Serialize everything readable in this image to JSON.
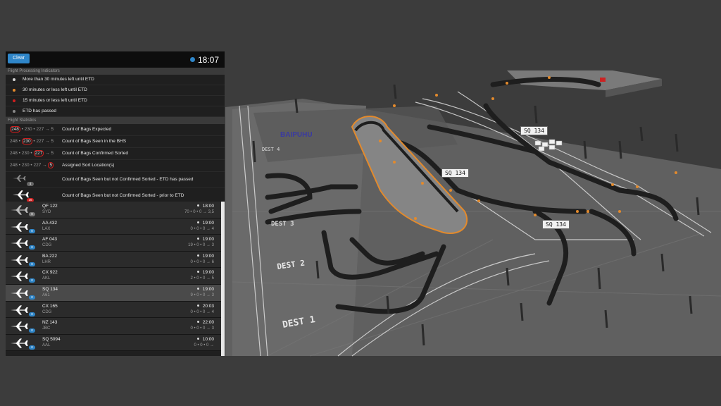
{
  "colors": {
    "accent": "#2f86c9",
    "alert": "#d01e1e",
    "conveyor_dot": "#e38a2c"
  },
  "header": {
    "clear_label": "Clear",
    "time": "18:07"
  },
  "indicators": {
    "title": "Flight Processing Indicators",
    "items": [
      {
        "label": "More than 30 minutes left until ETD",
        "color": "#d8d8d8"
      },
      {
        "label": "30 minutes or less left until ETD",
        "color": "#e38a2c"
      },
      {
        "label": "15 minutes or less left until ETD",
        "color": "#d01e1e"
      },
      {
        "label": "ETD has passed",
        "color": "#888888"
      }
    ]
  },
  "statistics": {
    "title": "Flight Statistics",
    "sep": "•",
    "arrow": "→",
    "values": [
      "248",
      "230",
      "227",
      "5"
    ],
    "rows": [
      {
        "label": "Count of Bags Expected"
      },
      {
        "label": "Count of Bags Seen in the BHS"
      },
      {
        "label": "Count of Bags Confirmed Sorted"
      },
      {
        "label": "Assigned Sort Location(s)"
      },
      {
        "label": "Count of Bags Seen but not Confirmed Sorted - ETD has passed",
        "badge": "4"
      },
      {
        "label": "Count of Bags Seen but not Confirmed Sorted - prior to ETD",
        "badge": "16"
      }
    ]
  },
  "flights": [
    {
      "code": "QF 122",
      "dest": "SYD",
      "time": "18:00",
      "counts": "70 • 0 • 0 → 3,5",
      "badge": "0",
      "badge_grey": true
    },
    {
      "code": "AA 432",
      "dest": "LAX",
      "time": "19:00",
      "counts": "0 • 0 • 0 → 4",
      "badge": "0"
    },
    {
      "code": "AF 043",
      "dest": "CDG",
      "time": "19:00",
      "counts": "19 • 0 • 0 → 3",
      "badge": "0"
    },
    {
      "code": "BA 222",
      "dest": "LHR",
      "time": "19:00",
      "counts": "0 • 0 • 0 → 6",
      "badge": "0"
    },
    {
      "code": "CX 922",
      "dest": "AKL",
      "time": "19:00",
      "counts": "2 • 0 • 0 → 5",
      "badge": "0"
    },
    {
      "code": "SQ 134",
      "dest": "A61",
      "time": "19:00",
      "counts": "9 • 0 • 0 → 3",
      "badge": "0",
      "selected": true
    },
    {
      "code": "CX 165",
      "dest": "CDG",
      "time": "20:03",
      "counts": "0 • 0 • 0 → 4",
      "badge": "0"
    },
    {
      "code": "NZ 143",
      "dest": "JBC",
      "time": "22:00",
      "counts": "0 • 0 • 0 → 3",
      "badge": "0"
    },
    {
      "code": "SQ 5094",
      "dest": "AAL",
      "time": "10:00",
      "counts": "0 • 0 • 0 →",
      "badge": "0"
    }
  ],
  "scene": {
    "flight_tags": [
      "SQ 134",
      "SQ 134",
      "SQ 134"
    ],
    "dest_labels": [
      "DEST 1",
      "DEST 2",
      "DEST 3",
      "DEST 4"
    ],
    "sign_text": "BAIPUHU"
  }
}
